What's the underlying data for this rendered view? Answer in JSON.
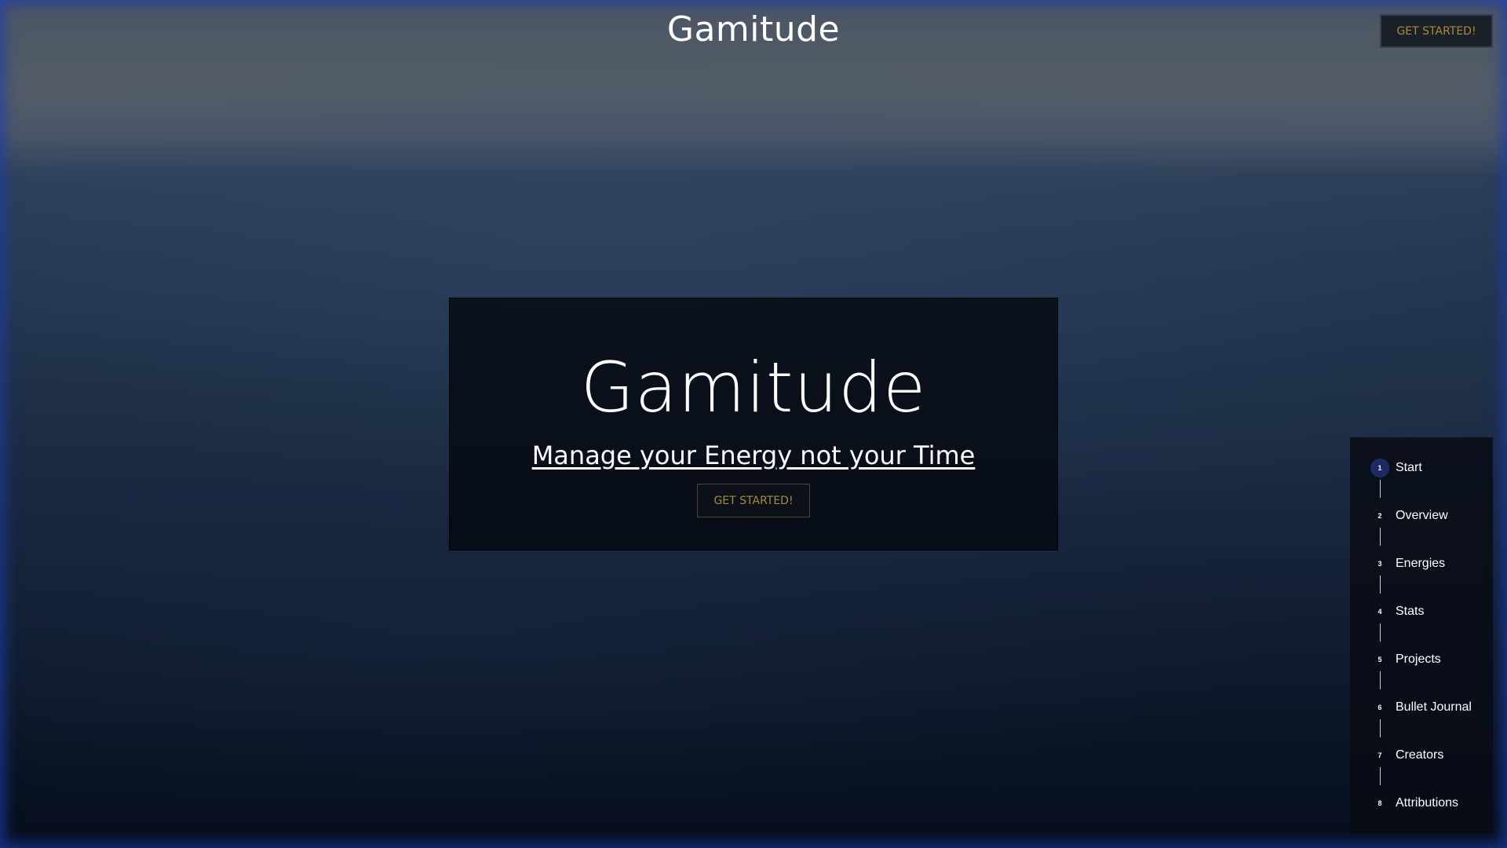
{
  "header": {
    "brand": "Gamitude",
    "cta_label": "GET STARTED!"
  },
  "hero": {
    "title": "Gamitude",
    "subtitle": "Manage your Energy not your Time",
    "cta_label": "GET STARTED!"
  },
  "sidenav": {
    "active_index": 1,
    "items": [
      {
        "num": "1",
        "label": "Start"
      },
      {
        "num": "2",
        "label": "Overview"
      },
      {
        "num": "3",
        "label": "Energies"
      },
      {
        "num": "4",
        "label": "Stats"
      },
      {
        "num": "5",
        "label": "Projects"
      },
      {
        "num": "6",
        "label": "Bullet Journal"
      },
      {
        "num": "7",
        "label": "Creators"
      },
      {
        "num": "8",
        "label": "Attributions"
      }
    ]
  },
  "colors": {
    "accent_gold": "#a98b3a",
    "active_step": "#1e2a66",
    "frame_glow": "#1e3caa"
  }
}
